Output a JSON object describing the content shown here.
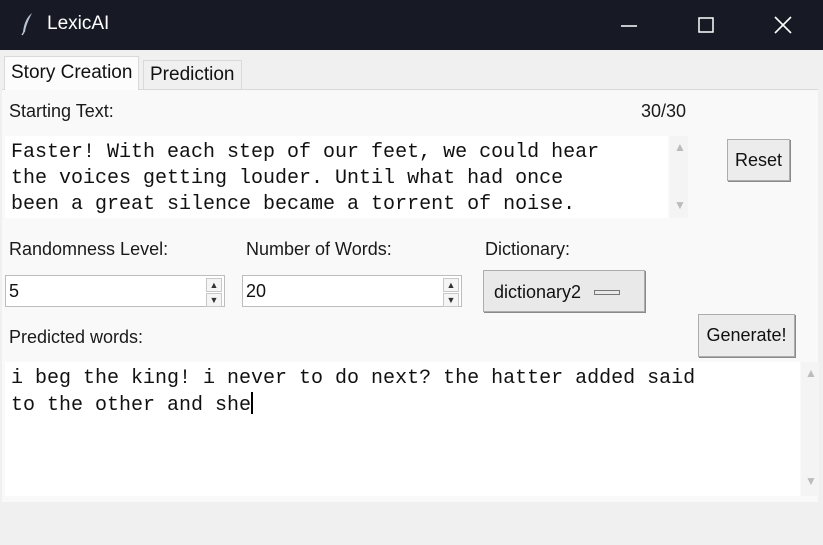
{
  "window": {
    "title": "LexicAI",
    "minimize_icon": "minimize-icon",
    "maximize_icon": "maximize-icon",
    "close_icon": "close-icon",
    "app_icon": "feather-icon"
  },
  "tabs": [
    {
      "label": "Story Creation",
      "active": true
    },
    {
      "label": "Prediction",
      "active": false
    }
  ],
  "starting_text": {
    "label": "Starting Text:",
    "counter": "30/30",
    "value": "Faster! With each step of our feet, we could hear\nthe voices getting louder. Until what had once\nbeen a great silence became a torrent of noise."
  },
  "reset_button": {
    "label": "Reset"
  },
  "randomness": {
    "label": "Randomness Level:",
    "value": "5"
  },
  "num_words": {
    "label": "Number of Words:",
    "value": "20"
  },
  "dictionary": {
    "label": "Dictionary:",
    "selected": "dictionary2"
  },
  "predicted": {
    "label": "Predicted words:",
    "value": "i beg the king! i never to do next? the hatter added said\nto the other and she"
  },
  "generate_button": {
    "label": "Generate!"
  }
}
